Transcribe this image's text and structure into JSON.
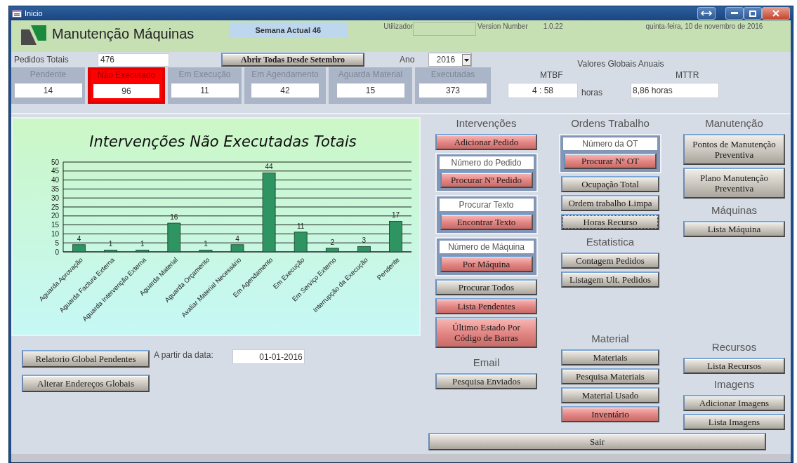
{
  "window": {
    "title": "Inicio"
  },
  "header": {
    "app_title": "Manutenção Máquinas",
    "week": "Semana Actual 46",
    "user_label": "Utilizador",
    "version_label": "Version Number",
    "version": "1.0.22",
    "date": "quinta-feira, 10 de novembro de 2016"
  },
  "totals": {
    "label": "Pedidos Totais",
    "value": "476",
    "button": "Abrir Todas Desde Setembro",
    "year_label": "Ano",
    "year": "2016"
  },
  "statuses": [
    {
      "label": "Pendente",
      "value": "14",
      "selected": false
    },
    {
      "label": "Não Executado",
      "value": "96",
      "selected": true
    },
    {
      "label": "Em Execução",
      "value": "11",
      "selected": false
    },
    {
      "label": "Em Agendamento",
      "value": "42",
      "selected": false
    },
    {
      "label": "Aguarda Material",
      "value": "15",
      "selected": false
    },
    {
      "label": "Executadas",
      "value": "373",
      "selected": false
    }
  ],
  "globals": {
    "title": "Valores Globais Anuais",
    "mtbf_label": "MTBF",
    "mtbf_value": "4 : 58",
    "mtbf_unit": "horas",
    "mttr_label": "MTTR",
    "mttr_value": "8,86 horas"
  },
  "chart": {
    "chart_data": {
      "type": "bar",
      "title": "Intervenções Não Executadas Totais",
      "categories": [
        "Aguarda Aprovação",
        "Aguarda Factura Externa",
        "Aguarda Intervenção Externa",
        "Aguarda Material",
        "Aguarda Orçamento",
        "Avaliar Material Necessário",
        "Em Agendamento",
        "Em Execução",
        "Em Serviço Externo",
        "Interrupção da Execução",
        "Pendente"
      ],
      "values": [
        4,
        1,
        1,
        16,
        1,
        4,
        44,
        11,
        2,
        3,
        17
      ],
      "ylim": [
        0,
        50
      ],
      "grid": true,
      "yticks": [
        0,
        5,
        10,
        15,
        20,
        25,
        30,
        35,
        40,
        45,
        50
      ],
      "data_labels": true
    }
  },
  "report": {
    "buttons": [
      {
        "label": "Relatorio Global Pendentes"
      },
      {
        "label": "Alterar Endereços Globais"
      }
    ],
    "date_label": "A partir da data:",
    "date_value": "01-01-2016"
  },
  "columns": [
    {
      "sections": [
        {
          "heading": "Intervenções",
          "items": [
            {
              "kind": "button",
              "label": "Adicionar Pedido",
              "highlighted": true,
              "focused": false
            },
            {
              "kind": "search",
              "prompt": "Número do Pedido",
              "label": "Procurar Nº Pedido",
              "highlighted": true,
              "focused": false
            },
            {
              "kind": "search",
              "prompt": "Procurar Texto",
              "label": "Encontrar Texto",
              "highlighted": true,
              "focused": false
            },
            {
              "kind": "search",
              "prompt": "Número de Máquina",
              "label": "Por Máquina",
              "highlighted": true,
              "focused": false
            },
            {
              "kind": "button",
              "label": "Procurar Todos",
              "highlighted": false,
              "focused": false
            },
            {
              "kind": "button",
              "label": "Lista Pendentes",
              "highlighted": true,
              "focused": false
            },
            {
              "kind": "button",
              "label": "Último Estado Por Código de Barras",
              "highlighted": true,
              "focused": false
            }
          ]
        },
        {
          "heading": "Email",
          "items": [
            {
              "kind": "button",
              "label": "Pesquisa Enviados",
              "highlighted": false,
              "focused": false
            }
          ]
        }
      ]
    },
    {
      "sections": [
        {
          "heading": "Ordens Trabalho",
          "items": [
            {
              "kind": "search",
              "prompt": "Número da OT",
              "label": "Procurar Nº OT",
              "highlighted": true,
              "focused": false
            },
            {
              "kind": "button",
              "label": "Ocupação Total",
              "highlighted": false,
              "focused": false
            },
            {
              "kind": "button",
              "label": "Ordem trabalho Limpa",
              "highlighted": false,
              "focused": false
            },
            {
              "kind": "button",
              "label": "Horas Recurso",
              "highlighted": false,
              "focused": true
            }
          ]
        },
        {
          "heading": "Estatistica",
          "items": [
            {
              "kind": "button",
              "label": "Contagem Pedidos",
              "highlighted": false,
              "focused": false
            },
            {
              "kind": "button",
              "label": "Listagem Ult. Pedidos",
              "highlighted": false,
              "focused": false
            }
          ]
        },
        {
          "heading": "Material",
          "items": [
            {
              "kind": "button",
              "label": "Materiais",
              "highlighted": false,
              "focused": false
            },
            {
              "kind": "button",
              "label": "Pesquisa Materiais",
              "highlighted": false,
              "focused": false
            },
            {
              "kind": "button",
              "label": "Material Usado",
              "highlighted": false,
              "focused": false
            },
            {
              "kind": "button",
              "label": "Inventário",
              "highlighted": true,
              "focused": false
            }
          ]
        }
      ]
    },
    {
      "sections": [
        {
          "heading": "Manutenção",
          "items": [
            {
              "kind": "button",
              "label": "Pontos de Manutenção Preventiva",
              "highlighted": false,
              "focused": false
            },
            {
              "kind": "button",
              "label": "Plano Manutenção Preventiva",
              "highlighted": false,
              "focused": false
            }
          ]
        },
        {
          "heading": "Máquinas",
          "items": [
            {
              "kind": "button",
              "label": "Lista Máquina",
              "highlighted": false,
              "focused": false
            }
          ]
        },
        {
          "heading": "Recursos",
          "items": [
            {
              "kind": "button",
              "label": "Lista Recursos",
              "highlighted": false,
              "focused": false
            }
          ]
        },
        {
          "heading": "Imagens",
          "items": [
            {
              "kind": "button",
              "label": "Adicionar Imagens",
              "highlighted": false,
              "focused": false
            },
            {
              "kind": "button",
              "label": "Lista Imagens",
              "highlighted": false,
              "focused": false
            }
          ]
        }
      ]
    }
  ],
  "exit_button": "Sair"
}
